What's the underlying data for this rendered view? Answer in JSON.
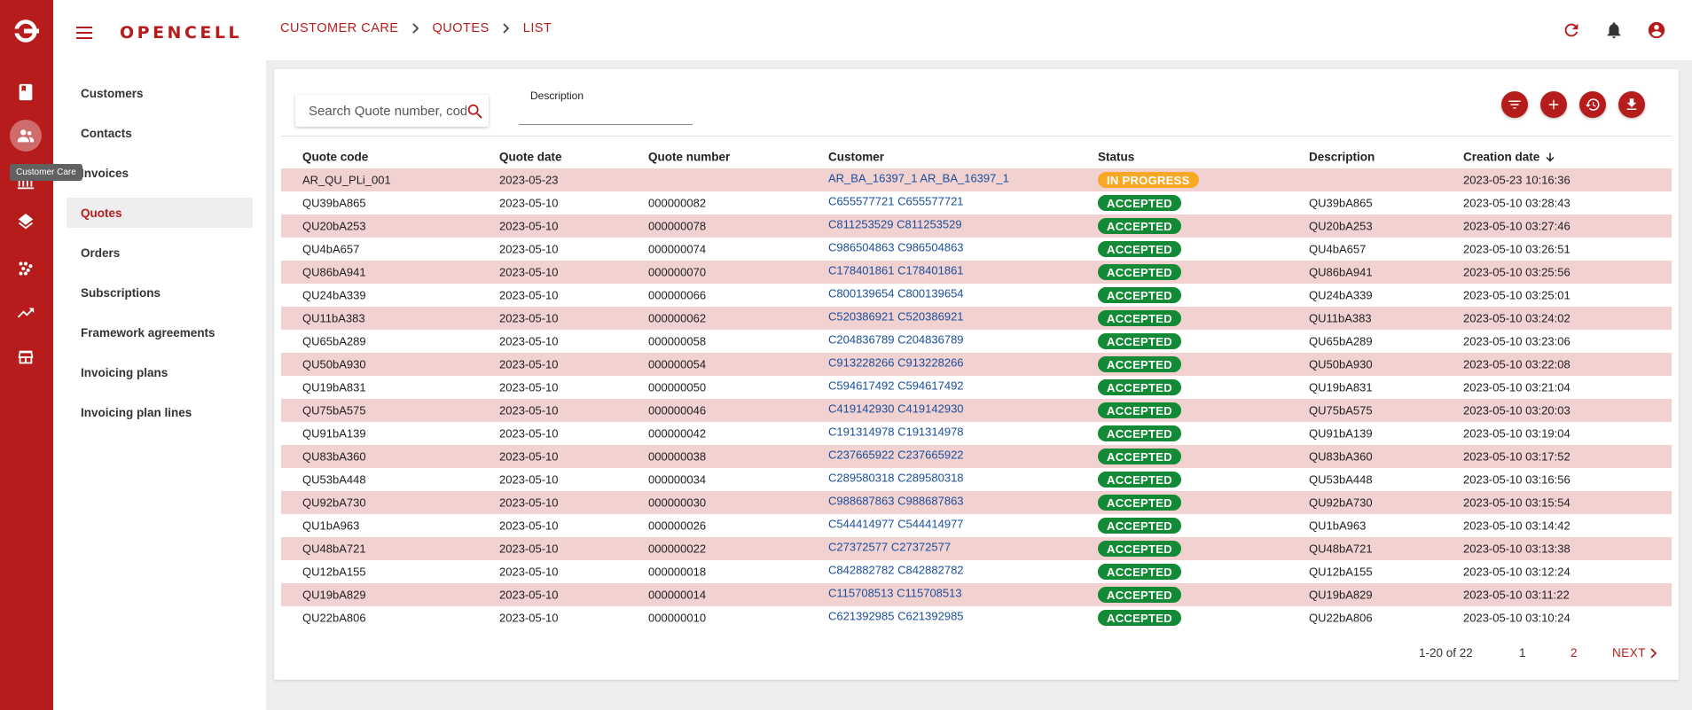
{
  "app": {
    "brand": "OPENCELL",
    "tooltip": "Customer Care",
    "rail_icons": [
      "logo-icon",
      "book-icon",
      "customer-care-icon",
      "invoicing-icon",
      "layers-icon",
      "catalog-icon",
      "reports-icon",
      "store-icon"
    ]
  },
  "breadcrumb": [
    "CUSTOMER CARE",
    "QUOTES",
    "LIST"
  ],
  "sidebar": {
    "items": [
      {
        "label": "Customers"
      },
      {
        "label": "Contacts"
      },
      {
        "label": "Invoices"
      },
      {
        "label": "Quotes",
        "active": true
      },
      {
        "label": "Orders"
      },
      {
        "label": "Subscriptions"
      },
      {
        "label": "Framework agreements"
      },
      {
        "label": "Invoicing plans"
      },
      {
        "label": "Invoicing plan lines"
      }
    ]
  },
  "search": {
    "placeholder": "Search Quote number, code"
  },
  "description_filter": {
    "label": "Description",
    "value": ""
  },
  "actions": [
    "filter-icon",
    "add-icon",
    "history-icon",
    "download-icon"
  ],
  "table": {
    "columns": [
      "Quote code",
      "Quote date",
      "Quote number",
      "Customer",
      "Status",
      "Description",
      "Creation date"
    ],
    "rows": [
      {
        "code": "AR_QU_PLi_001",
        "qdate": "2023-05-23",
        "qnum": "",
        "customer": "AR_BA_16397_1 AR_BA_16397_1",
        "status": "IN PROGRESS",
        "desc": "",
        "cdate": "2023-05-23 10:16:36"
      },
      {
        "code": "QU39bA865",
        "qdate": "2023-05-10",
        "qnum": "000000082",
        "customer": "C655577721 C655577721",
        "status": "ACCEPTED",
        "desc": "QU39bA865",
        "cdate": "2023-05-10 03:28:43"
      },
      {
        "code": "QU20bA253",
        "qdate": "2023-05-10",
        "qnum": "000000078",
        "customer": "C811253529 C811253529",
        "status": "ACCEPTED",
        "desc": "QU20bA253",
        "cdate": "2023-05-10 03:27:46"
      },
      {
        "code": "QU4bA657",
        "qdate": "2023-05-10",
        "qnum": "000000074",
        "customer": "C986504863 C986504863",
        "status": "ACCEPTED",
        "desc": "QU4bA657",
        "cdate": "2023-05-10 03:26:51"
      },
      {
        "code": "QU86bA941",
        "qdate": "2023-05-10",
        "qnum": "000000070",
        "customer": "C178401861 C178401861",
        "status": "ACCEPTED",
        "desc": "QU86bA941",
        "cdate": "2023-05-10 03:25:56"
      },
      {
        "code": "QU24bA339",
        "qdate": "2023-05-10",
        "qnum": "000000066",
        "customer": "C800139654 C800139654",
        "status": "ACCEPTED",
        "desc": "QU24bA339",
        "cdate": "2023-05-10 03:25:01"
      },
      {
        "code": "QU11bA383",
        "qdate": "2023-05-10",
        "qnum": "000000062",
        "customer": "C520386921 C520386921",
        "status": "ACCEPTED",
        "desc": "QU11bA383",
        "cdate": "2023-05-10 03:24:02"
      },
      {
        "code": "QU65bA289",
        "qdate": "2023-05-10",
        "qnum": "000000058",
        "customer": "C204836789 C204836789",
        "status": "ACCEPTED",
        "desc": "QU65bA289",
        "cdate": "2023-05-10 03:23:06"
      },
      {
        "code": "QU50bA930",
        "qdate": "2023-05-10",
        "qnum": "000000054",
        "customer": "C913228266 C913228266",
        "status": "ACCEPTED",
        "desc": "QU50bA930",
        "cdate": "2023-05-10 03:22:08"
      },
      {
        "code": "QU19bA831",
        "qdate": "2023-05-10",
        "qnum": "000000050",
        "customer": "C594617492 C594617492",
        "status": "ACCEPTED",
        "desc": "QU19bA831",
        "cdate": "2023-05-10 03:21:04"
      },
      {
        "code": "QU75bA575",
        "qdate": "2023-05-10",
        "qnum": "000000046",
        "customer": "C419142930 C419142930",
        "status": "ACCEPTED",
        "desc": "QU75bA575",
        "cdate": "2023-05-10 03:20:03"
      },
      {
        "code": "QU91bA139",
        "qdate": "2023-05-10",
        "qnum": "000000042",
        "customer": "C191314978 C191314978",
        "status": "ACCEPTED",
        "desc": "QU91bA139",
        "cdate": "2023-05-10 03:19:04"
      },
      {
        "code": "QU83bA360",
        "qdate": "2023-05-10",
        "qnum": "000000038",
        "customer": "C237665922 C237665922",
        "status": "ACCEPTED",
        "desc": "QU83bA360",
        "cdate": "2023-05-10 03:17:52"
      },
      {
        "code": "QU53bA448",
        "qdate": "2023-05-10",
        "qnum": "000000034",
        "customer": "C289580318 C289580318",
        "status": "ACCEPTED",
        "desc": "QU53bA448",
        "cdate": "2023-05-10 03:16:56"
      },
      {
        "code": "QU92bA730",
        "qdate": "2023-05-10",
        "qnum": "000000030",
        "customer": "C988687863 C988687863",
        "status": "ACCEPTED",
        "desc": "QU92bA730",
        "cdate": "2023-05-10 03:15:54"
      },
      {
        "code": "QU1bA963",
        "qdate": "2023-05-10",
        "qnum": "000000026",
        "customer": "C544414977 C544414977",
        "status": "ACCEPTED",
        "desc": "QU1bA963",
        "cdate": "2023-05-10 03:14:42"
      },
      {
        "code": "QU48bA721",
        "qdate": "2023-05-10",
        "qnum": "000000022",
        "customer": "C27372577 C27372577",
        "status": "ACCEPTED",
        "desc": "QU48bA721",
        "cdate": "2023-05-10 03:13:38"
      },
      {
        "code": "QU12bA155",
        "qdate": "2023-05-10",
        "qnum": "000000018",
        "customer": "C842882782 C842882782",
        "status": "ACCEPTED",
        "desc": "QU12bA155",
        "cdate": "2023-05-10 03:12:24"
      },
      {
        "code": "QU19bA829",
        "qdate": "2023-05-10",
        "qnum": "000000014",
        "customer": "C115708513 C115708513",
        "status": "ACCEPTED",
        "desc": "QU19bA829",
        "cdate": "2023-05-10 03:11:22"
      },
      {
        "code": "QU22bA806",
        "qdate": "2023-05-10",
        "qnum": "000000010",
        "customer": "C621392985 C621392985",
        "status": "ACCEPTED",
        "desc": "QU22bA806",
        "cdate": "2023-05-10 03:10:24"
      }
    ]
  },
  "pagination": {
    "range": "1-20 of 22",
    "pages": [
      "1",
      "2"
    ],
    "next": "NEXT"
  },
  "colors": {
    "brand": "#b71c1c",
    "accepted": "#138a36",
    "in_progress": "#f9a825",
    "row_stripe": "#f2d1d1",
    "link": "#1a4f9c"
  }
}
